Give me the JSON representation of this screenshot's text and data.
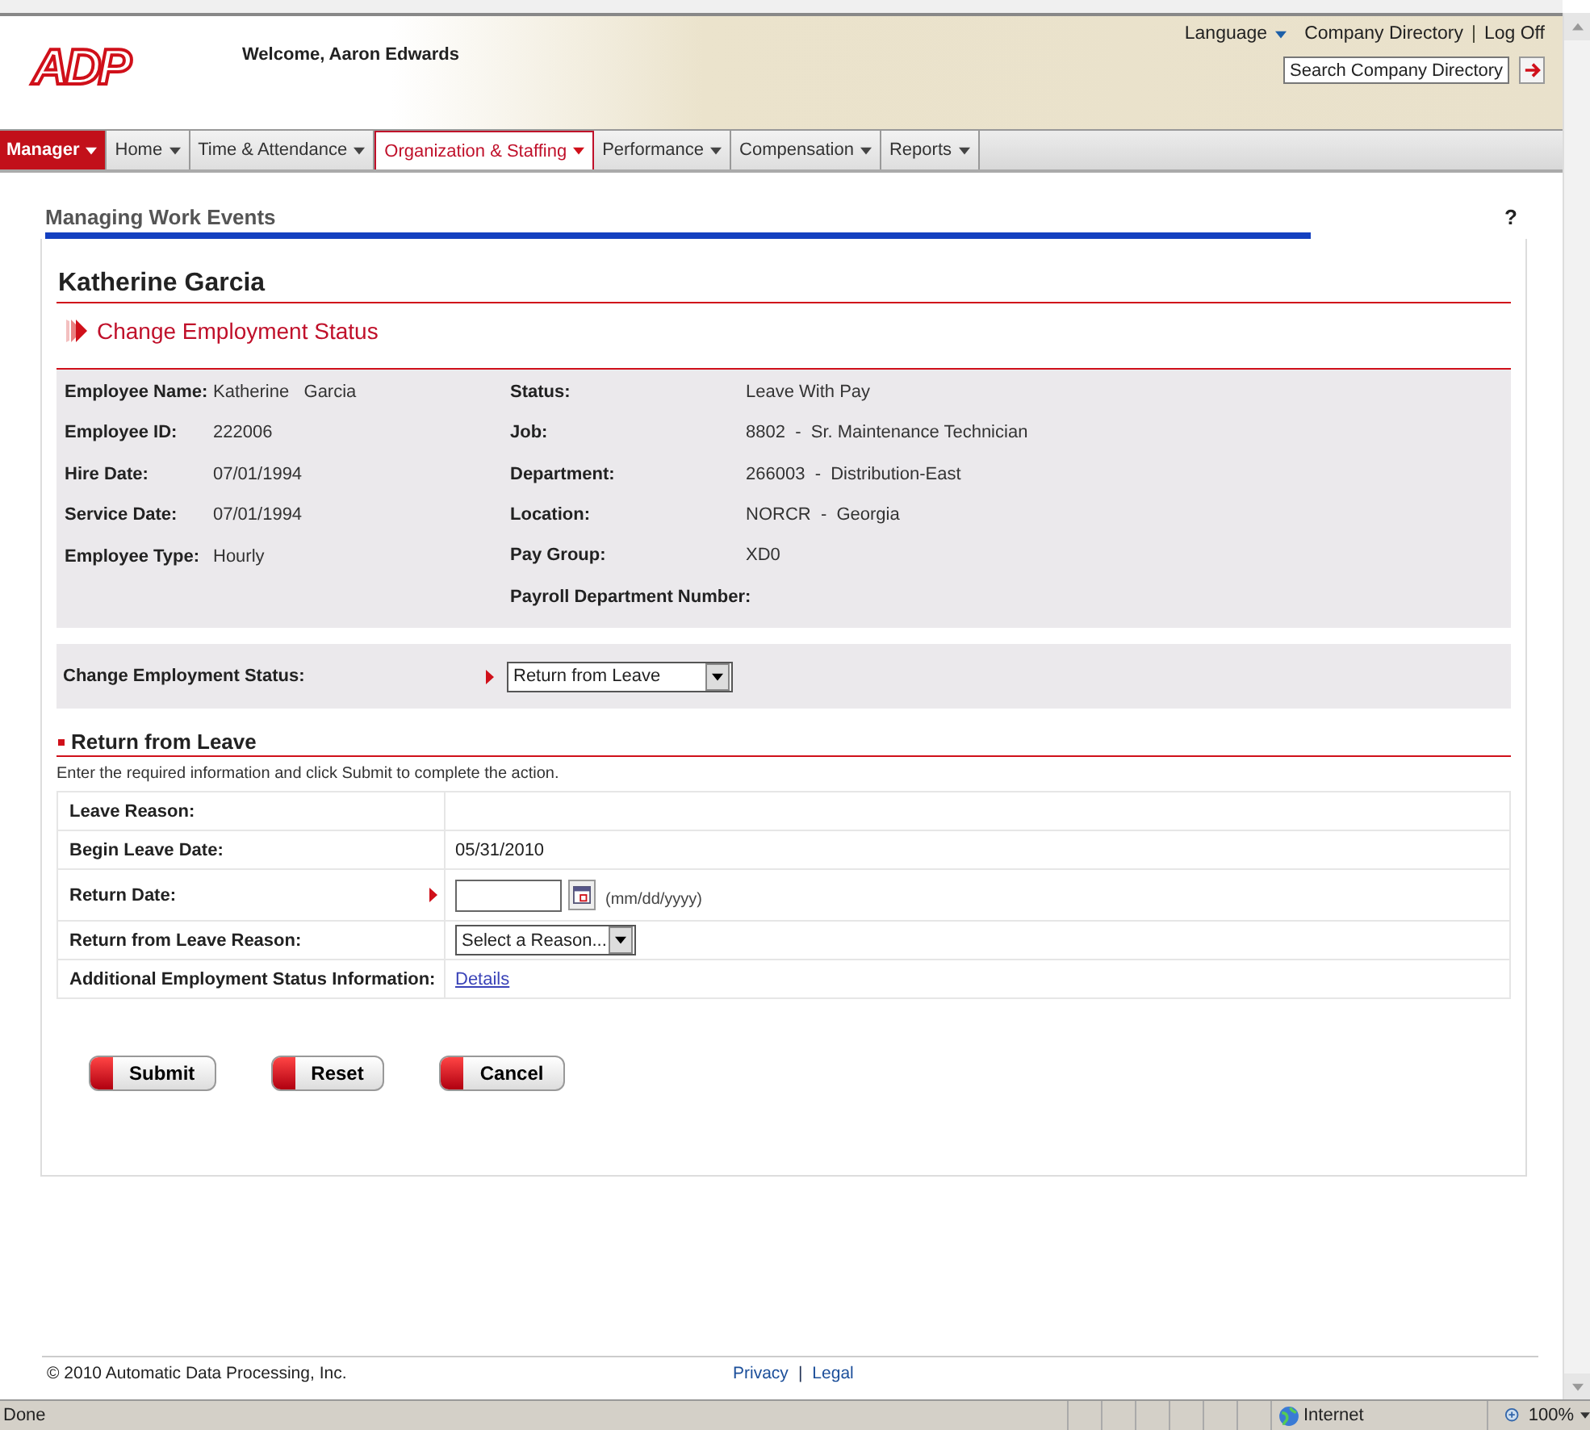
{
  "header": {
    "logo": "ADP",
    "welcome": "Welcome, Aaron Edwards",
    "language": "Language",
    "company_directory": "Company Directory",
    "separator": "|",
    "log_off": "Log Off",
    "search": {
      "placeholder": "Search Company Directory"
    }
  },
  "nav": [
    {
      "label": "Manager",
      "kind": "role",
      "selected": false
    },
    {
      "label": "Home",
      "kind": "tab",
      "selected": false
    },
    {
      "label": "Time & Attendance",
      "kind": "tab",
      "selected": false
    },
    {
      "label": "Organization & Staffing",
      "kind": "tab",
      "selected": true
    },
    {
      "label": "Performance",
      "kind": "tab",
      "selected": false
    },
    {
      "label": "Compensation",
      "kind": "tab",
      "selected": false
    },
    {
      "label": "Reports",
      "kind": "tab",
      "selected": false
    }
  ],
  "page_title": "Managing Work Events",
  "help": "?",
  "employee_heading": "Katherine Garcia",
  "action_title": "Change Employment Status",
  "info_left": [
    {
      "label": "Employee Name:",
      "value": "Katherine   Garcia"
    },
    {
      "label": "Employee ID:",
      "value": "222006"
    },
    {
      "label": "Hire Date:",
      "value": "07/01/1994"
    },
    {
      "label": "Service Date:",
      "value": "07/01/1994"
    },
    {
      "label": "Employee Type:",
      "value": "Hourly"
    }
  ],
  "info_right": [
    {
      "label": "Status:",
      "value": "Leave With Pay"
    },
    {
      "label": "Job:",
      "value": "8802  -  Sr. Maintenance Technician"
    },
    {
      "label": "Department:",
      "value": "266003  -  Distribution-East"
    },
    {
      "label": "Location:",
      "value": "NORCR  -  Georgia"
    },
    {
      "label": "Pay Group:",
      "value": "XD0"
    },
    {
      "label": "Payroll Department Number:"
    }
  ],
  "change_status": {
    "label": "Change Employment Status:",
    "required": true,
    "value": "Return from Leave"
  },
  "section_title": "Return from Leave",
  "instructions": "Enter the required information and click Submit to complete the action.",
  "form_rows": [
    {
      "label": "Leave Reason:",
      "kind": "text",
      "required": false
    },
    {
      "label": "Begin Leave Date:",
      "kind": "text",
      "value": "05/31/2010",
      "required": false
    },
    {
      "label": "Return Date:",
      "kind": "date",
      "hint": "(mm/dd/yyyy)",
      "required": true
    },
    {
      "label": "Return from Leave Reason:",
      "kind": "select",
      "value": "Select a Reason...",
      "required": false
    },
    {
      "label": "Additional Employment Status Information:",
      "kind": "link",
      "value": "Details",
      "required": false
    }
  ],
  "buttons": [
    "Submit",
    "Reset",
    "Cancel"
  ],
  "footer": {
    "copyright": "© 2010 Automatic Data Processing, Inc.",
    "privacy": "Privacy",
    "separator": "|",
    "legal": "Legal"
  },
  "status_bar": {
    "status": "Done",
    "zone": "Internet",
    "zoom": "100%"
  }
}
